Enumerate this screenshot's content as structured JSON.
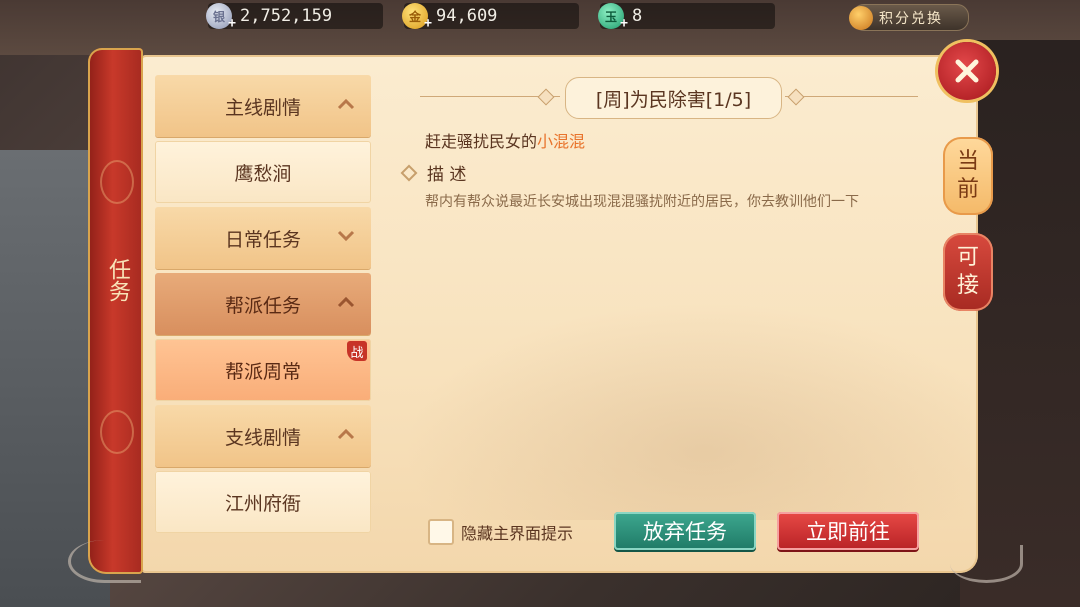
{
  "currency": {
    "silver": {
      "icon": "silver-coin-icon",
      "value": "2,752,159"
    },
    "gold": {
      "icon": "gold-coin-icon",
      "value": "94,609"
    },
    "jade": {
      "icon": "jade-icon",
      "value": "8"
    }
  },
  "points_exchange": {
    "label": "积分兑换",
    "icon": "money-bag-icon"
  },
  "panel": {
    "title": "任务"
  },
  "categories": [
    {
      "label": "主线剧情",
      "type": "header",
      "expanded": true
    },
    {
      "label": "鹰愁涧",
      "type": "sub"
    },
    {
      "label": "日常任务",
      "type": "header",
      "expanded": false
    },
    {
      "label": "帮派任务",
      "type": "header",
      "expanded": true
    },
    {
      "label": "帮派周常",
      "type": "sub",
      "selected": true,
      "badge": "战"
    },
    {
      "label": "支线剧情",
      "type": "header",
      "expanded": true
    },
    {
      "label": "江州府衙",
      "type": "sub"
    }
  ],
  "quest": {
    "title": "[周]为民除害[1/5]",
    "goal_prefix": "赶走骚扰民女的",
    "goal_target": "小混混",
    "desc_heading": "描 述",
    "description": "帮内有帮众说最近长安城出现混混骚扰附近的居民，你去教训他们一下"
  },
  "controls": {
    "hide_hint_label": "隐藏主界面提示",
    "abandon_label": "放弃任务",
    "go_label": "立即前往"
  },
  "side_tabs": {
    "current": [
      "当",
      "前"
    ],
    "available": [
      "可",
      "接"
    ]
  },
  "colors": {
    "accent_orange": "#e8742c",
    "abandon_green": "#1f7a66",
    "go_red": "#b82226",
    "spine_red": "#c8392a"
  }
}
